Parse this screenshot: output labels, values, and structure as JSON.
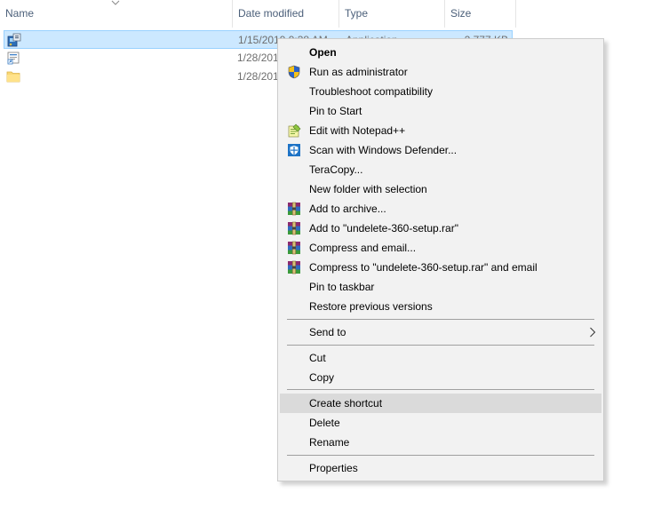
{
  "columns": {
    "name": "Name",
    "date": "Date modified",
    "type": "Type",
    "size": "Size"
  },
  "files": [
    {
      "icon": "setup-application-icon",
      "date": "1/15/2019 9:38 AM",
      "type": "Application",
      "size": "2,777 KB",
      "selected": true
    },
    {
      "icon": "shortcut-file-icon",
      "date": "1/28/2019",
      "type": "",
      "size": "",
      "selected": false
    },
    {
      "icon": "folder-icon",
      "date": "1/28/2019",
      "type": "",
      "size": "",
      "selected": false
    }
  ],
  "menu": {
    "open": "Open",
    "run_as_admin": "Run as administrator",
    "troubleshoot": "Troubleshoot compatibility",
    "pin_start": "Pin to Start",
    "edit_notepad": "Edit with Notepad++",
    "scan_defender": "Scan with Windows Defender...",
    "teracopy": "TeraCopy...",
    "new_folder_selection": "New folder with selection",
    "add_archive": "Add to archive...",
    "add_to_rar": "Add to \"undelete-360-setup.rar\"",
    "compress_email": "Compress and email...",
    "compress_rar_email": "Compress to \"undelete-360-setup.rar\" and email",
    "pin_taskbar": "Pin to taskbar",
    "restore_versions": "Restore previous versions",
    "send_to": "Send to",
    "cut": "Cut",
    "copy": "Copy",
    "create_shortcut": "Create shortcut",
    "delete": "Delete",
    "rename": "Rename",
    "properties": "Properties"
  },
  "colors": {
    "selection_bg": "#cce8ff",
    "menu_bg": "#f2f2f2",
    "menu_hover": "#dadada",
    "header_text": "#4c607a"
  }
}
